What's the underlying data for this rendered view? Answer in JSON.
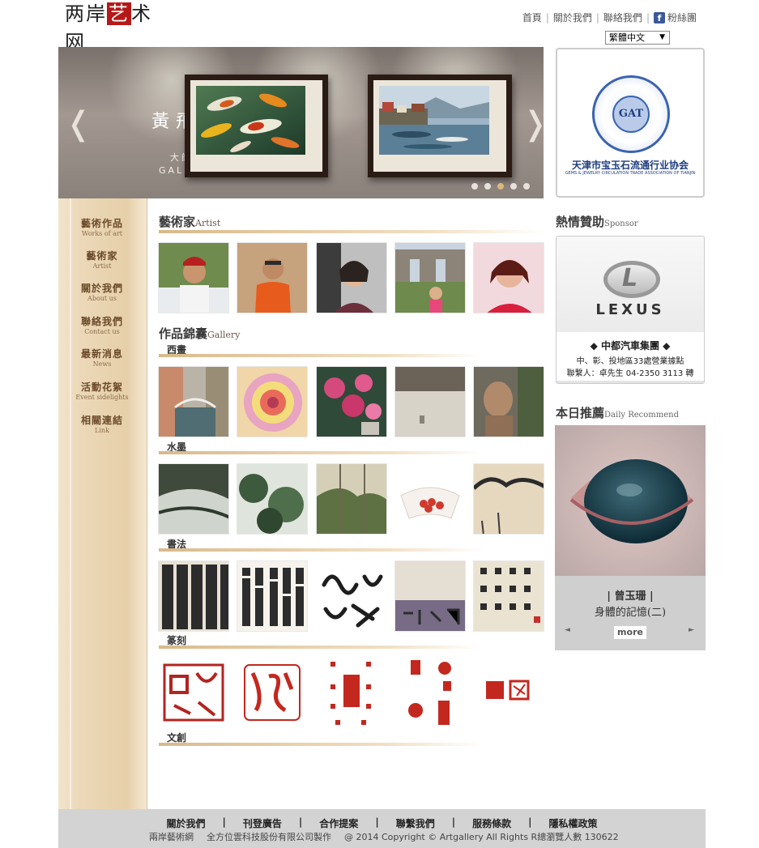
{
  "header": {
    "logo_text": "两岸艺术网",
    "nav": [
      {
        "label": "首頁"
      },
      {
        "label": "關於我們"
      },
      {
        "label": "聯絡我們"
      },
      {
        "label": "粉絲團"
      }
    ],
    "facebook_icon": "f",
    "language_select": "繁體中文"
  },
  "banner": {
    "artist_name": "黃飛",
    "subtitle_zh": "大師藝廊",
    "subtitle_en": "GALLERY",
    "prev_arrow": "❬",
    "next_arrow": "❭",
    "slide_count": 5,
    "active_slide": 3
  },
  "sponsor_badge": {
    "center_text": "GAT",
    "name_zh": "天津市宝玉石流通行业协会",
    "name_en": "GEMS & JEWELRY CIRCULATION TRADE ASSOCIATION OF TIANJIN"
  },
  "sidebar": {
    "items": [
      {
        "zh": "藝術作品",
        "en": "Works of art"
      },
      {
        "zh": "藝術家",
        "en": "Artist"
      },
      {
        "zh": "關於我們",
        "en": "About us"
      },
      {
        "zh": "聯絡我們",
        "en": "Contact us"
      },
      {
        "zh": "最新消息",
        "en": "News"
      },
      {
        "zh": "活動花絮",
        "en": "Event sidelights"
      },
      {
        "zh": "相關連結",
        "en": "Link"
      }
    ]
  },
  "main": {
    "artist_section": {
      "title": "藝術家",
      "title_en": "Artist"
    },
    "gallery_section": {
      "title": "作品錦囊",
      "title_en": "Gallery"
    },
    "categories": [
      {
        "label": "西畫"
      },
      {
        "label": "水墨"
      },
      {
        "label": "書法"
      },
      {
        "label": "篆刻"
      },
      {
        "label": "文創"
      }
    ]
  },
  "right": {
    "sponsor_title": "熱情贊助",
    "sponsor_title_en": "Sponsor",
    "lexus": {
      "brand": "LEXUS",
      "group": "◆ 中都汽車集團 ◆",
      "address": "中、彰、投地區33處營業據點",
      "contact": "聯繫人：卓先生 04-2350 3113 轉"
    },
    "recommend_title": "本日推薦",
    "recommend_title_en": "Daily Recommend",
    "recommend": {
      "artist": "| 曾玉珊 |",
      "work": "身體的記憶(二)",
      "more": "more",
      "prev": "◄",
      "next": "►"
    }
  },
  "footer": {
    "links": [
      {
        "label": "關於我們"
      },
      {
        "label": "刊登廣告"
      },
      {
        "label": "合作提案"
      },
      {
        "label": "聯繫我們"
      },
      {
        "label": "服務條款"
      },
      {
        "label": "隱私權政策"
      }
    ],
    "site_name": "兩岸藝術網",
    "maker": "全方位雲科技股份有限公司製作",
    "copyright": "@ 2014 Copyright © Artgallery All Rights R總瀏覽人數 130622"
  },
  "colors": {
    "accent_red": "#b51818",
    "menu_brown": "#6b4a2a",
    "footer_gray": "#d3d3d3"
  }
}
